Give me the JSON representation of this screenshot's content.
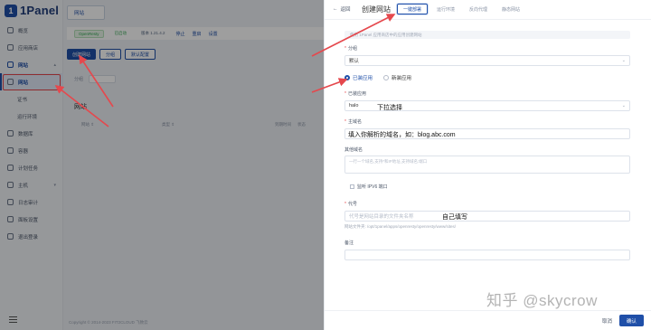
{
  "app": {
    "logo_letter": "1",
    "name": "1Panel"
  },
  "sidebar": {
    "items": [
      {
        "label": "概览",
        "icon": "dashboard-icon"
      },
      {
        "label": "应用商店",
        "icon": "store-icon"
      },
      {
        "label": "网站",
        "icon": "globe-icon"
      },
      {
        "label": "网站",
        "icon": "site-icon"
      },
      {
        "label": "证书",
        "icon": ""
      },
      {
        "label": "运行环境",
        "icon": ""
      },
      {
        "label": "数据库",
        "icon": "database-icon"
      },
      {
        "label": "容器",
        "icon": "container-icon"
      },
      {
        "label": "计划任务",
        "icon": "clock-icon"
      },
      {
        "label": "主机",
        "icon": "host-icon"
      },
      {
        "label": "日志审计",
        "icon": "log-icon"
      },
      {
        "label": "面板设置",
        "icon": "settings-icon"
      },
      {
        "label": "退出登录",
        "icon": "logout-icon"
      }
    ]
  },
  "main": {
    "top_button": "网站",
    "status": {
      "chip1": "OpenResty",
      "chip2": "已启动",
      "version": "版本 1.21.4.2",
      "links": [
        "停止",
        "重启",
        "设置"
      ]
    },
    "actions": [
      "创建网站",
      "分组",
      "默认配置"
    ],
    "filter_label": "分组",
    "filter_value": "默认",
    "section_title": "网站",
    "columns": [
      "网站 ⇕",
      "类型 ⇕",
      "到期时间",
      "状态"
    ],
    "copyright": "Copyright © 2014-2023 FIT2CLOUD 飞致云"
  },
  "drawer": {
    "back": "返回",
    "title": "创建网站",
    "tabs": [
      "一键部署",
      "运行环境",
      "反向代理",
      "静态网站"
    ],
    "note": "使用 1Panel 应用商店中的应用创建网站",
    "group_label": "分组",
    "group_value": "默认",
    "radio_installed": "已装应用",
    "radio_new": "新装应用",
    "installed_app_label": "已装应用",
    "installed_app_value": "halo",
    "annot_dropdown": "下拉选择",
    "primary_domain_label": "主域名",
    "primary_domain_annot": "填入你解析的域名，如：blog.abc.com",
    "other_domains_label": "其他域名",
    "other_domains_placeholder": "一行一个域名,支持*和IP地址,支持域名:端口",
    "ipv6_label": "监听 IPV6 端口",
    "alias_label": "代号",
    "alias_placeholder": "代号是网站目录的文件夹名称",
    "alias_annot": "自己填写",
    "alias_hint": "网站文件夹: /opt/1panel/apps/openresty/openresty/www/sites/",
    "remark_label": "备注",
    "cancel": "取消",
    "confirm": "确认"
  },
  "watermark": "知乎 @skycrow",
  "colors": {
    "brand": "#1f4fa8",
    "annotation": "#e5484d",
    "success": "#34a853"
  }
}
